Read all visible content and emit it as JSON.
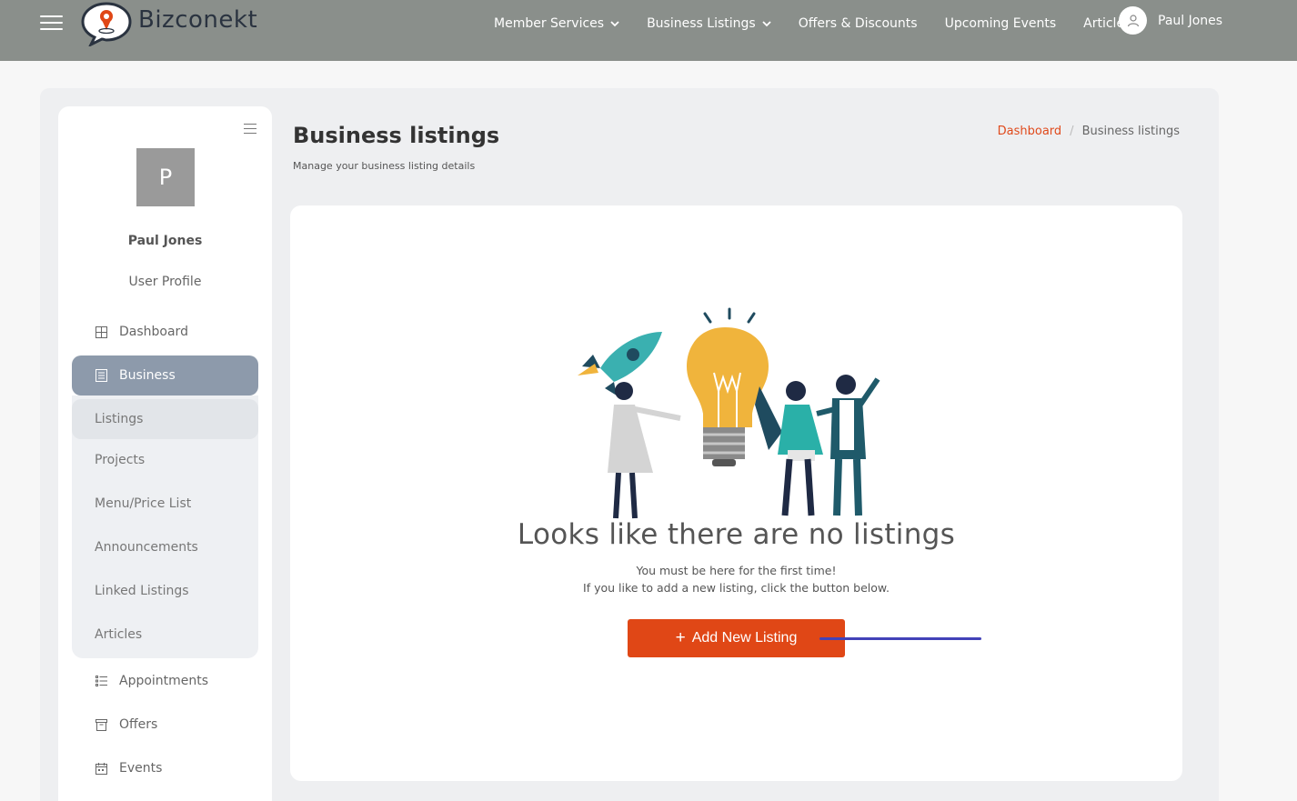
{
  "brand": {
    "name": "Bizconekt"
  },
  "nav": {
    "items": [
      {
        "label": "Member Services",
        "dropdown": true
      },
      {
        "label": "Business Listings",
        "dropdown": true
      },
      {
        "label": "Offers & Discounts",
        "dropdown": false
      },
      {
        "label": "Upcoming Events",
        "dropdown": false
      },
      {
        "label": "Articles",
        "dropdown": false
      }
    ],
    "user_name": "Paul Jones"
  },
  "sidebar": {
    "avatar_initial": "P",
    "user_name": "Paul Jones",
    "profile_link": "User Profile",
    "dashboard": "Dashboard",
    "business": "Business",
    "business_sub": [
      "Listings",
      "Projects",
      "Menu/Price List",
      "Announcements",
      "Linked Listings",
      "Articles"
    ],
    "appointments": "Appointments",
    "offers": "Offers",
    "events": "Events"
  },
  "page": {
    "title": "Business listings",
    "subtitle": "Manage your business listing details",
    "breadcrumb": {
      "home": "Dashboard",
      "separator": "/",
      "current": "Business listings"
    }
  },
  "empty_state": {
    "title": "Looks like there are no listings",
    "line1": "You must be here for the first time!",
    "line2": "If you like to add a new listing, click the button below.",
    "button_label": "Add New Listing"
  },
  "colors": {
    "topbar": "#8a8f8b",
    "accent": "#e04716",
    "sidebar_active": "#8d9aab",
    "annotation": "#4342b8"
  }
}
